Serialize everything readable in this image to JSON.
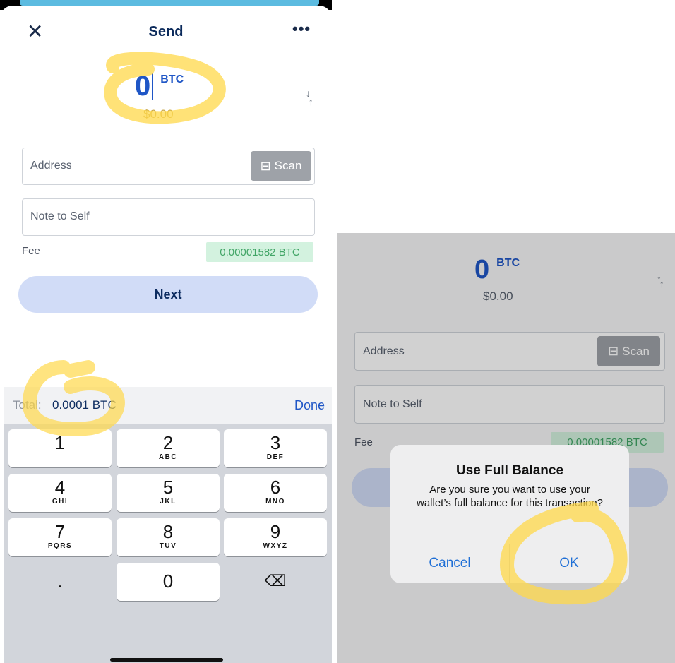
{
  "left": {
    "header": {
      "title": "Send",
      "close_icon": "close-icon",
      "more_icon": "more-icon"
    },
    "amount": {
      "value": "0",
      "unit": "BTC",
      "fiat": "$0.00"
    },
    "address": {
      "placeholder": "Address",
      "scan_label": "Scan"
    },
    "note": {
      "placeholder": "Note to Self"
    },
    "fee": {
      "label": "Fee",
      "value": "0.00001582 BTC"
    },
    "next_label": "Next",
    "keyboard_toolbar": {
      "total_label": "Total:",
      "total_value": "0.0001 BTC",
      "done_label": "Done"
    },
    "keypad": [
      {
        "digit": "1",
        "letters": ""
      },
      {
        "digit": "2",
        "letters": "ABC"
      },
      {
        "digit": "3",
        "letters": "DEF"
      },
      {
        "digit": "4",
        "letters": "GHI"
      },
      {
        "digit": "5",
        "letters": "JKL"
      },
      {
        "digit": "6",
        "letters": "MNO"
      },
      {
        "digit": "7",
        "letters": "PQRS"
      },
      {
        "digit": "8",
        "letters": "TUV"
      },
      {
        "digit": "9",
        "letters": "WXYZ"
      },
      {
        "digit": ".",
        "letters": ""
      },
      {
        "digit": "0",
        "letters": ""
      },
      {
        "digit": "⌫",
        "letters": ""
      }
    ]
  },
  "right": {
    "amount": {
      "value": "0",
      "unit": "BTC",
      "fiat": "$0.00"
    },
    "address": {
      "placeholder": "Address",
      "scan_label": "Scan"
    },
    "note": {
      "placeholder": "Note to Self"
    },
    "fee": {
      "label": "Fee",
      "value": "0.00001582 BTC"
    },
    "dialog": {
      "title": "Use Full Balance",
      "message": "Are you sure you want to use your wallet’s full balance for this transaction?",
      "cancel_label": "Cancel",
      "ok_label": "OK"
    }
  },
  "colors": {
    "accent_blue": "#1f56c6",
    "fee_green": "#41a566",
    "highlighter": "#ffd84a"
  }
}
